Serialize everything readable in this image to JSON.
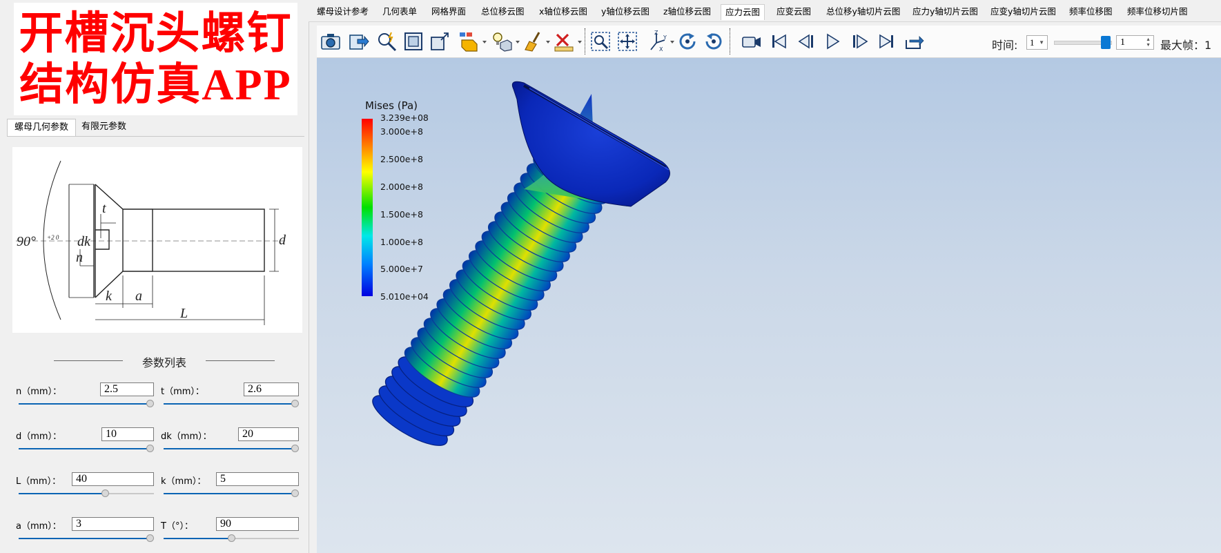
{
  "banner": {
    "line1": "开槽沉头螺钉",
    "line2": "结构仿真APP"
  },
  "left_tabs": [
    "螺母几何参数",
    "有限元参数"
  ],
  "diagram": {
    "labels": {
      "angle": "90°",
      "angle_tol": "+2 0",
      "dk": "dk",
      "t": "t",
      "n": "n",
      "k": "k",
      "a": "a",
      "L": "L",
      "d": "d"
    }
  },
  "param_list_title": "参数列表",
  "params": [
    {
      "label": "n（mm）：",
      "value": "2.5",
      "level": 1.0
    },
    {
      "label": "t（mm）：",
      "value": "2.6",
      "level": 1.0
    },
    {
      "label": "d（mm）：",
      "value": "10",
      "level": 1.0
    },
    {
      "label": "dk（mm）：",
      "value": "20",
      "level": 1.0
    },
    {
      "label": "L（mm）：",
      "value": "40",
      "level": 0.65
    },
    {
      "label": "k（mm）：",
      "value": "5",
      "level": 1.0
    },
    {
      "label": "a（mm）：",
      "value": "3",
      "level": 1.0
    },
    {
      "label": "T（°）：",
      "value": "90",
      "level": 0.5
    }
  ],
  "nav_tabs": [
    "螺母设计参考",
    "几何表单",
    "网格界面",
    "总位移云图",
    "x轴位移云图",
    "y轴位移云图",
    "z轴位移云图",
    "应力云图",
    "应变云图",
    "总位移y轴切片云图",
    "应力y轴切片云图",
    "应变y轴切片云图",
    "频率位移图",
    "频率位移切片图"
  ],
  "active_nav_tab": "应力云图",
  "toolbar_icons": [
    "camera-icon",
    "export-icon",
    "probe-icon",
    "view-fit-icon",
    "view-3d-icon",
    "select-cells-icon",
    "light-icon",
    "clear-icon",
    "ruler-icon",
    "zoom-box-icon",
    "pan-icon",
    "axes-icon",
    "rotate-cw-icon",
    "rotate-ccw-icon",
    "record-icon",
    "first-frame-icon",
    "prev-frame-icon",
    "play-icon",
    "next-frame-icon",
    "last-frame-icon",
    "loop-icon"
  ],
  "time": {
    "label": "时间:",
    "value": "1"
  },
  "frame": {
    "value": "1",
    "max_label": "最大帧：1"
  },
  "legend": {
    "title": "Mises (Pa)",
    "ticks": [
      "3.239e+08",
      "3.000e+8",
      "2.500e+8",
      "2.000e+8",
      "1.500e+8",
      "1.000e+8",
      "5.000e+7",
      "5.010e+04"
    ]
  },
  "colors": {
    "accent": "#0a64b4",
    "banner_text": "#ff0000"
  }
}
